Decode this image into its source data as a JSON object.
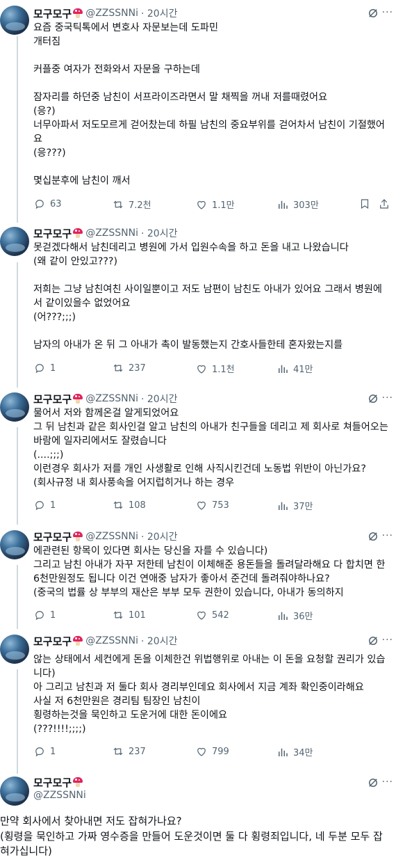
{
  "author": {
    "name": "모구모구",
    "handle": "@ZZSSNNi"
  },
  "tweets": [
    {
      "time": "· 20시간",
      "text": "요즘 중국틱톡에서 변호사 자문보는데 도파민\n개터짐\n\n커플중 여자가 전화와서 자문을 구하는데\n\n잠자리를 하던중 남친이 서프라이즈라면서 말 채찍을 꺼내 저를때렸어요\n(응?)\n너무아파서 저도모르게 걷어찼는데 하필 남친의 중요부위를 걷어차서 남친이 기절했어요\n(응???)\n\n몇십분후에 남친이 깨서",
      "replies": "63",
      "retweets": "7.2천",
      "likes": "1.1만",
      "views": "303만"
    },
    {
      "time": "· 20시간",
      "text": "못걷겠다해서 남친데리고 병원에 가서 입원수속을 하고 돈을 내고 나왔습니다\n(왜 같이 안있고???)\n\n저희는 그냥 남친여친 사이일뿐이고 저도 남편이 남친도 아내가 있어요 그래서 병원에서 같이있을수 없었어요\n(어???;;;)\n\n남자의 아내가 온 뒤 그 아내가 촉이 발동했는지 간호사들한테 혼자왔는지를",
      "replies": "1",
      "retweets": "237",
      "likes": "1.1천",
      "views": "41만"
    },
    {
      "time": "· 20시간",
      "text": "물어서 저와 함께온걸 알게되었어요\n그 뒤 남친과 같은 회사인걸 알고 남친의 아내가 친구들을 데리고 제 회사로 쳐들어오는 바람에 일자리에서도 잘렸습니다\n(....;;;)\n이런경우 회사가 저를 개인 사생활로 인해 사직시킨건데 노동법 위반이 아닌가요?\n(회사규정 내 회사풍속을 어지럽히거나 하는 경우",
      "replies": "1",
      "retweets": "108",
      "likes": "753",
      "views": "37만"
    },
    {
      "time": "· 20시간",
      "text": "에관련된 항목이 있다면 회사는 당신을 자를 수 있습니다)\n그리고 남친 아내가 자꾸 저한테 남친이 이체해준 용돈들을 돌려달라해요 다 합치면 한 6천만원정도 됩니다 이건 연애중 남자가 좋아서 준건데 돌려줘야하나요?\n(중국의 법률 상 부부의 재산은 부부 모두 권한이 있습니다, 아내가 동의하지",
      "replies": "1",
      "retweets": "101",
      "likes": "542",
      "views": "36만"
    },
    {
      "time": "· 20시간",
      "text": "않는 상태에서 세컨에게 돈을 이체한건 위법행위로 아내는 이 돈을 요청할 권리가 있습니다)\n아 그리고 남친과 저 둘다 회사 경리부인데요 회사에서 지금 계좌 확인중이라해요\n사실 저 6천만원은 경리팀 팀장인 남친이\n횡령하는것을 묵인하고 도운거에 대한 돈이에요\n(???!!!!;;;;)",
      "replies": "1",
      "retweets": "237",
      "likes": "799",
      "views": "34만"
    }
  ],
  "main_tweet": {
    "text": "만약 회사에서 찾아내면 저도 잡혀가나요?\n(횡령을 묵인하고 가짜 영수증을 만들어 도운것이면 둘 다 횡령죄입니다, 네 두분 모두 잡혀가십니다)"
  },
  "more_label": "···",
  "colors": {
    "text": "#0f1419",
    "secondary": "#536471",
    "thread_line": "#cfd9de",
    "mushroom_cap": "#e0245e"
  },
  "icons": [
    "reply-icon",
    "retweet-icon",
    "like-icon",
    "views-icon",
    "bookmark-icon",
    "share-icon",
    "grok-icon",
    "more-icon"
  ]
}
